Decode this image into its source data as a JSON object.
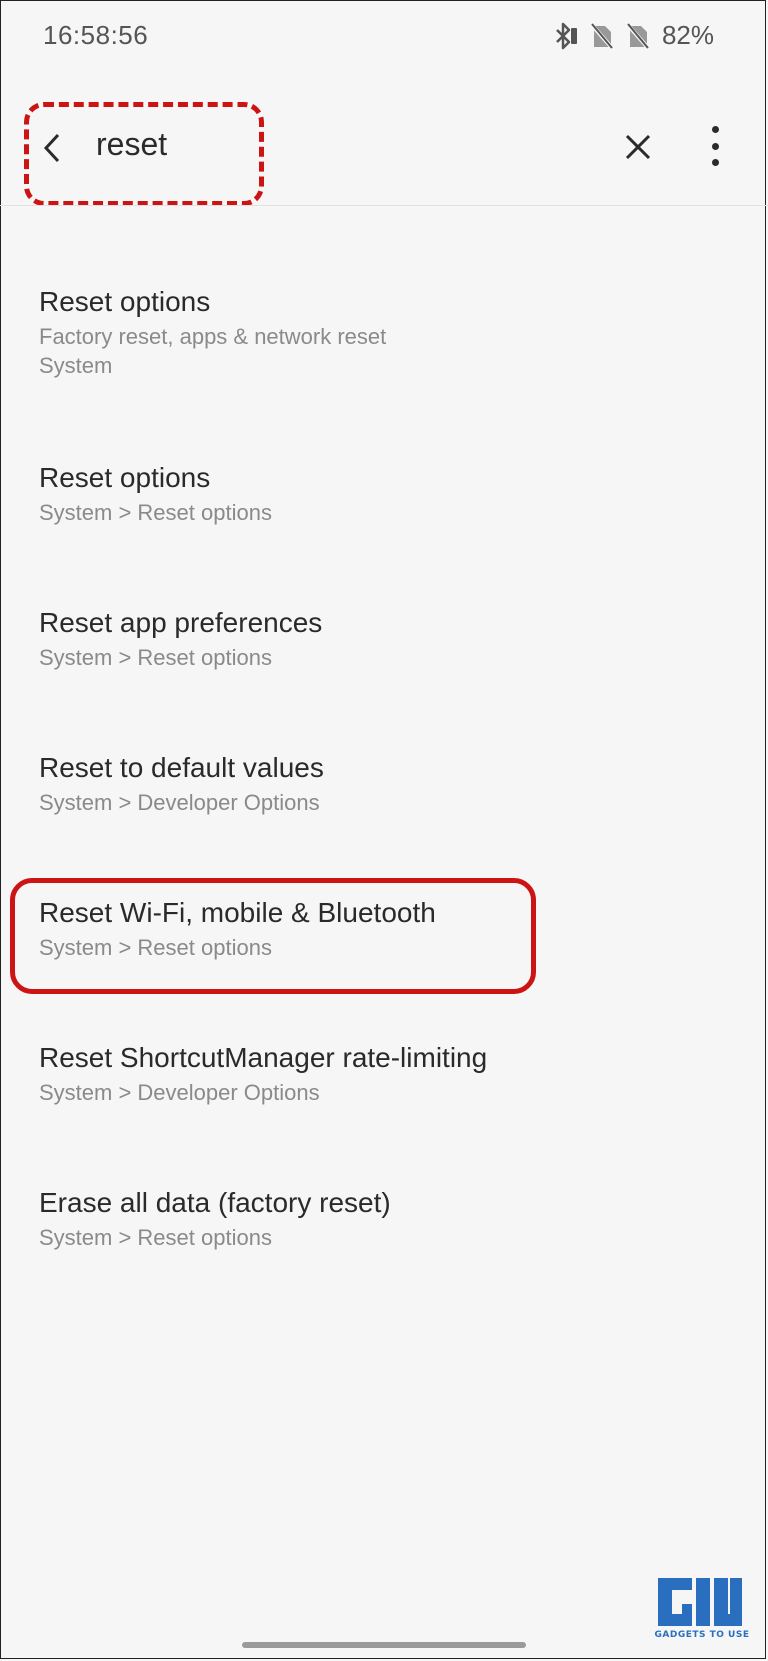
{
  "status_bar": {
    "time": "16:58:56",
    "battery": "82%",
    "icons": [
      "bluetooth-icon",
      "no-sim-icon",
      "no-sim-icon"
    ]
  },
  "search": {
    "query": "reset",
    "back_icon": "back-arrow-icon",
    "clear_icon": "close-icon",
    "menu_icon": "more-vert-icon"
  },
  "results": [
    {
      "title": "Reset options",
      "subtitle": "Factory reset, apps & network reset",
      "path": "System"
    },
    {
      "title": "Reset options",
      "subtitle": "System > Reset options"
    },
    {
      "title": "Reset app preferences",
      "subtitle": "System > Reset options"
    },
    {
      "title": "Reset to default values",
      "subtitle": "System > Developer Options"
    },
    {
      "title": "Reset Wi-Fi, mobile & Bluetooth",
      "subtitle": "System > Reset options"
    },
    {
      "title": "Reset ShortcutManager rate-limiting",
      "subtitle": "System > Developer Options"
    },
    {
      "title": "Erase all data (factory reset)",
      "subtitle": "System > Reset options"
    }
  ],
  "watermark": {
    "text": "GADGETS TO USE"
  },
  "colors": {
    "annotation": "#cc1414",
    "background": "#f6f6f6",
    "watermark": "#2a6fbf"
  }
}
